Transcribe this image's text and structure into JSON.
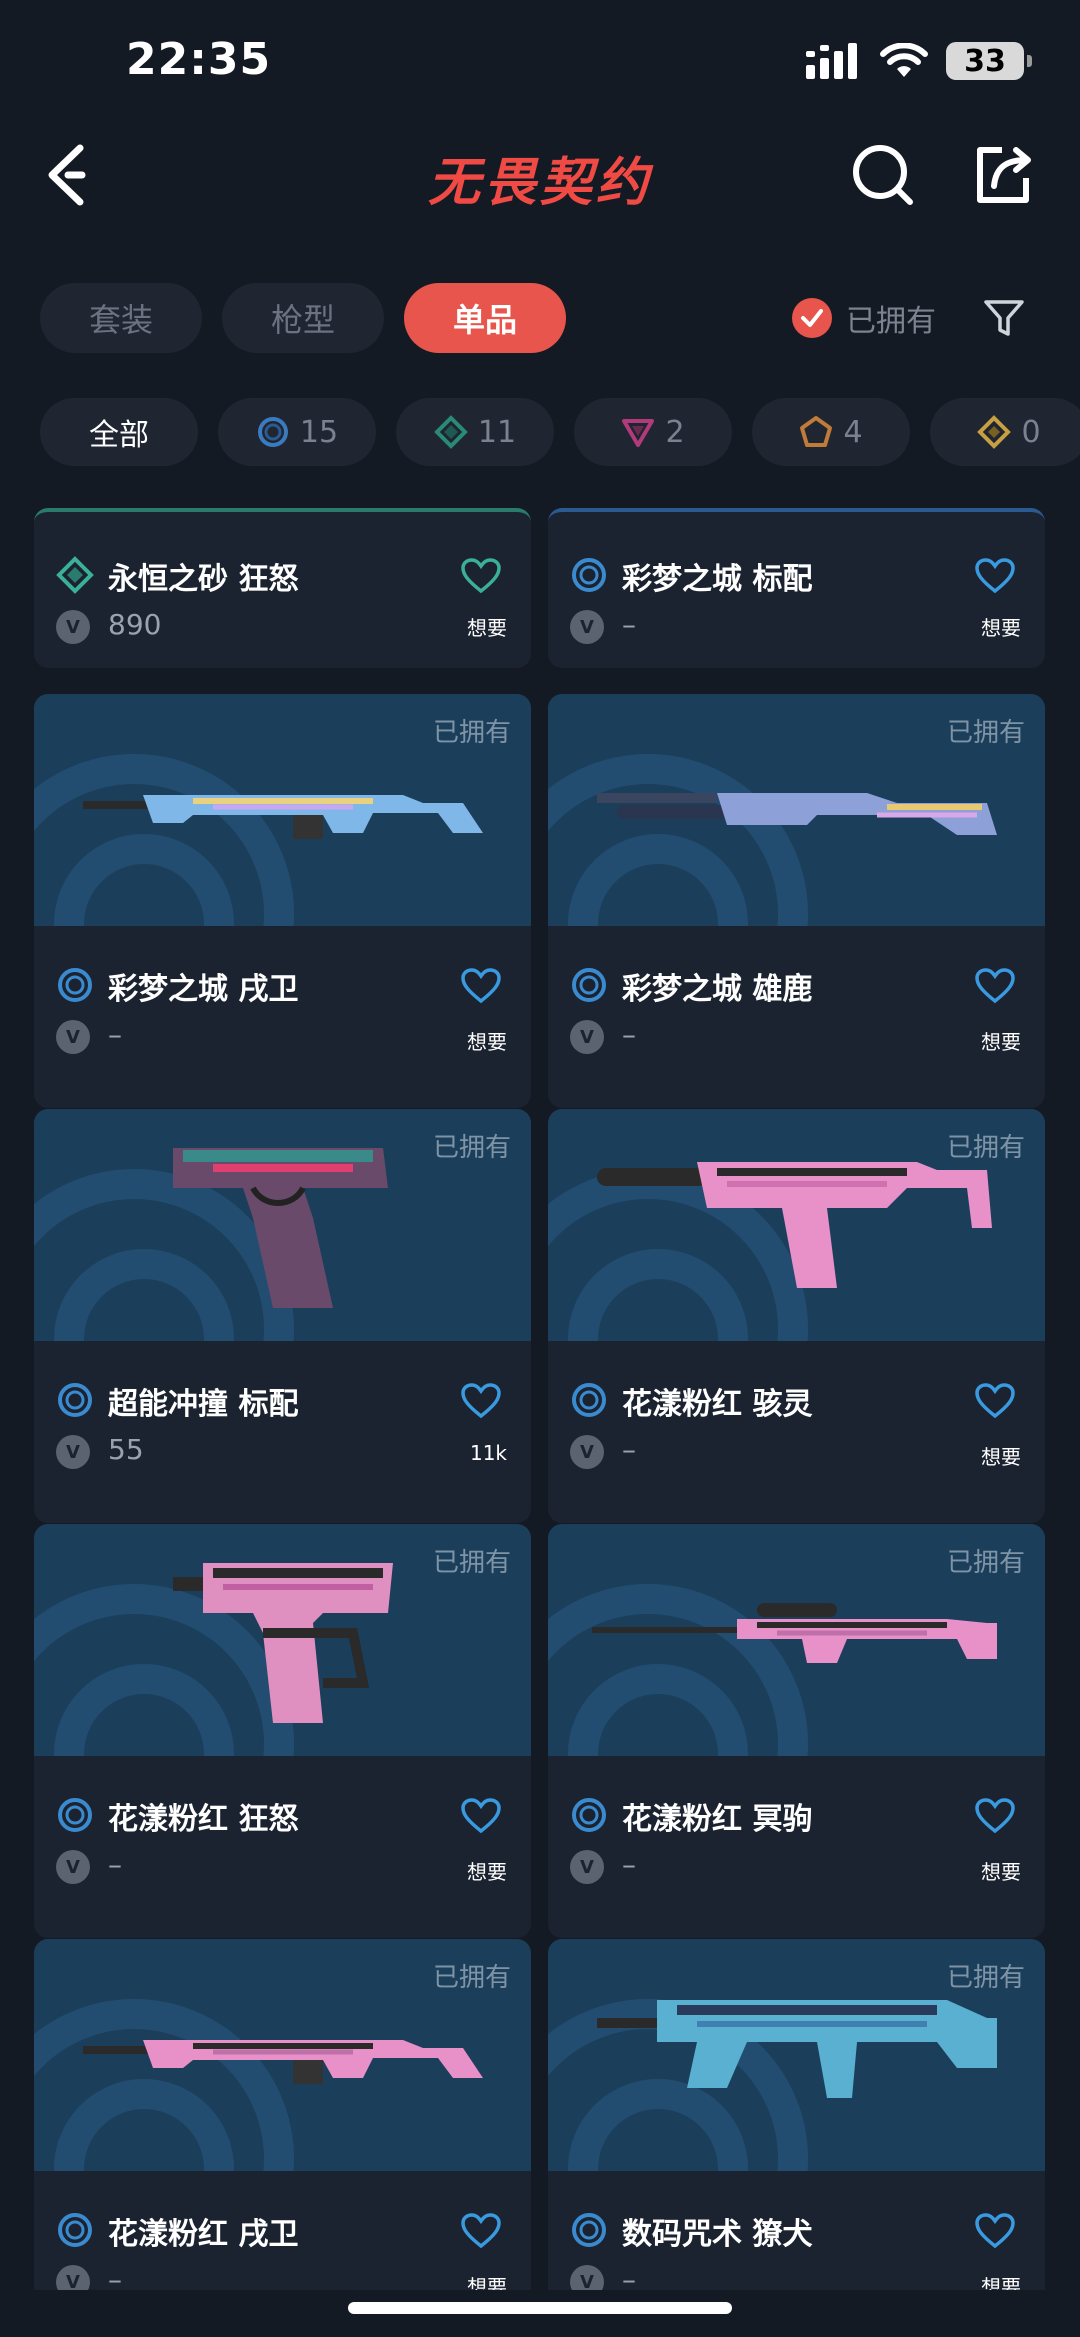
{
  "status": {
    "time": "22:35",
    "battery": "33"
  },
  "nav": {
    "title": "无畏契约"
  },
  "tabs": [
    {
      "label": "套装",
      "active": false
    },
    {
      "label": "枪型",
      "active": false
    },
    {
      "label": "单品",
      "active": true
    }
  ],
  "owned_filter": {
    "label": "已拥有",
    "checked": true
  },
  "tiers": [
    {
      "label": "全部",
      "icon": ""
    },
    {
      "label": "15",
      "icon": "select-tier-icon"
    },
    {
      "label": "11",
      "icon": "deluxe-tier-icon"
    },
    {
      "label": "2",
      "icon": "premium-tier-icon"
    },
    {
      "label": "4",
      "icon": "exclusive-tier-icon"
    },
    {
      "label": "0",
      "icon": "ultra-tier-icon"
    }
  ],
  "partial_cards": [
    {
      "name": "永恒之砂 狂怒",
      "price": "890",
      "want": "想要",
      "tier": "deluxe"
    },
    {
      "name": "彩梦之城 标配",
      "price": "–",
      "want": "想要",
      "tier": "select"
    }
  ],
  "cards": [
    {
      "owned": "已拥有",
      "name": "彩梦之城 戌卫",
      "price": "–",
      "want": "想要",
      "tier": "select",
      "weapon": "rifle",
      "colors": [
        "#7fb8e8",
        "#e8d27f",
        "#c8a8f0"
      ]
    },
    {
      "owned": "已拥有",
      "name": "彩梦之城 雄鹿",
      "price": "–",
      "want": "想要",
      "tier": "select",
      "weapon": "shotgun",
      "colors": [
        "#8ea0d8",
        "#e8c870",
        "#d8a8e8"
      ]
    },
    {
      "owned": "已拥有",
      "name": "超能冲撞 标配",
      "price": "55",
      "want": "11k",
      "tier": "select",
      "weapon": "pistol",
      "colors": [
        "#6a4a6a",
        "#3a8a8a",
        "#e04070"
      ]
    },
    {
      "owned": "已拥有",
      "name": "花漾粉红 骇灵",
      "price": "–",
      "want": "想要",
      "tier": "select",
      "weapon": "smg",
      "colors": [
        "#e890c8",
        "#2a2a2a",
        "#d070b0"
      ]
    },
    {
      "owned": "已拥有",
      "name": "花漾粉红 狂怒",
      "price": "–",
      "want": "想要",
      "tier": "select",
      "weapon": "frenzy",
      "colors": [
        "#e090c0",
        "#2a2a2a",
        "#c060a0"
      ]
    },
    {
      "owned": "已拥有",
      "name": "花漾粉红 冥驹",
      "price": "–",
      "want": "想要",
      "tier": "select",
      "weapon": "sniper",
      "colors": [
        "#e890c8",
        "#2a2a2a",
        "#c070a8"
      ]
    },
    {
      "owned": "已拥有",
      "name": "花漾粉红 戌卫",
      "price": "–",
      "want": "想要",
      "tier": "select",
      "weapon": "rifle",
      "colors": [
        "#e890c8",
        "#2a2a2a",
        "#c070a8"
      ]
    },
    {
      "owned": "已拥有",
      "name": "数码咒术 獠犬",
      "price": "–",
      "want": "想要",
      "tier": "select",
      "weapon": "bulldog",
      "colors": [
        "#5ab0d0",
        "#2a3a5a",
        "#4080b0"
      ]
    }
  ]
}
